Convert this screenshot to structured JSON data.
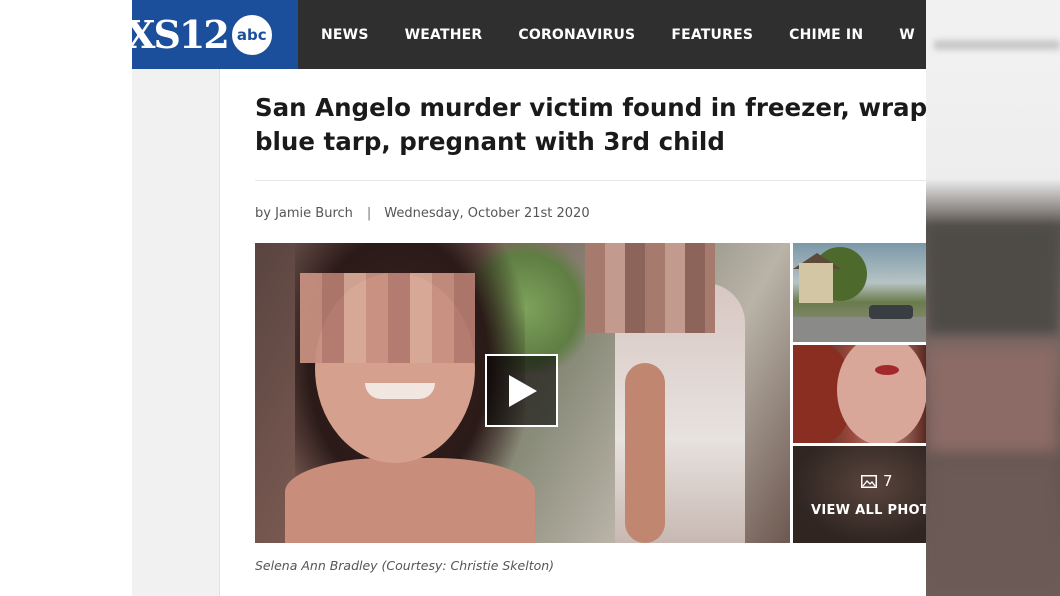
{
  "header": {
    "logo_text": "XS12",
    "network_logo": "abc",
    "nav": [
      "NEWS",
      "WEATHER",
      "CORONAVIRUS",
      "FEATURES",
      "CHIME IN",
      "W"
    ]
  },
  "article": {
    "headline_line1": "San Angelo murder victim found in freezer, wrapped",
    "headline_line2": "blue tarp, pregnant with 3rd child",
    "author": "by Jamie Burch",
    "separator": "|",
    "date": "Wednesday, October 21st 2020",
    "caption": "Selena Ann Bradley (Courtesy: Christie Skelton)"
  },
  "gallery": {
    "photo_count": "7",
    "view_all_label": "VIEW ALL PHOT",
    "play_icon": "play-icon",
    "gallery_icon": "image-icon"
  },
  "colors": {
    "header_bg": "#2f2f2f",
    "logo_bg": "#1b4f9b",
    "headline": "#1a1a1a"
  }
}
